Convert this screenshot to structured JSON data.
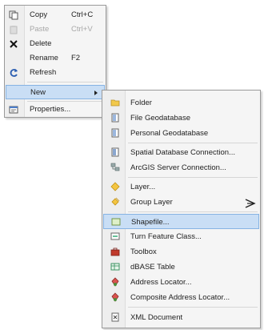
{
  "context_menu": {
    "items": [
      {
        "label": "Copy",
        "shortcut": "Ctrl+C",
        "icon": "copy-icon",
        "disabled": false
      },
      {
        "label": "Paste",
        "shortcut": "Ctrl+V",
        "icon": "paste-icon",
        "disabled": true
      },
      {
        "label": "Delete",
        "shortcut": "",
        "icon": "delete-icon",
        "disabled": false
      },
      {
        "label": "Rename",
        "shortcut": "F2",
        "icon": "",
        "disabled": false
      },
      {
        "label": "Refresh",
        "shortcut": "",
        "icon": "refresh-icon",
        "disabled": false
      },
      {
        "label": "New",
        "shortcut": "",
        "icon": "",
        "disabled": false,
        "highlighted": true,
        "submenu": true
      },
      {
        "label": "Properties...",
        "shortcut": "",
        "icon": "properties-icon",
        "disabled": false
      }
    ]
  },
  "new_submenu": {
    "items": [
      {
        "label": "Folder",
        "icon": "folder-icon"
      },
      {
        "label": "File Geodatabase",
        "icon": "file-geodatabase-icon"
      },
      {
        "label": "Personal Geodatabase",
        "icon": "personal-geodatabase-icon"
      },
      {
        "label": "Spatial Database Connection...",
        "icon": "spatial-database-connection-icon"
      },
      {
        "label": "ArcGIS Server Connection...",
        "icon": "arcgis-server-connection-icon"
      },
      {
        "label": "Layer...",
        "icon": "layer-icon"
      },
      {
        "label": "Group Layer",
        "icon": "group-layer-icon"
      },
      {
        "label": "Shapefile...",
        "icon": "shapefile-icon",
        "highlighted": true
      },
      {
        "label": "Turn Feature Class...",
        "icon": "feature-class-icon"
      },
      {
        "label": "Toolbox",
        "icon": "toolbox-icon"
      },
      {
        "label": "dBASE Table",
        "icon": "dbase-table-icon"
      },
      {
        "label": "Address Locator...",
        "icon": "address-locator-icon"
      },
      {
        "label": "Composite Address Locator...",
        "icon": "composite-address-locator-icon"
      },
      {
        "label": "XML Document",
        "icon": "xml-document-icon"
      }
    ]
  },
  "colors": {
    "highlight_bg": "#c9def5",
    "highlight_border": "#86b3e3",
    "disabled_text": "#a8a8a8"
  }
}
